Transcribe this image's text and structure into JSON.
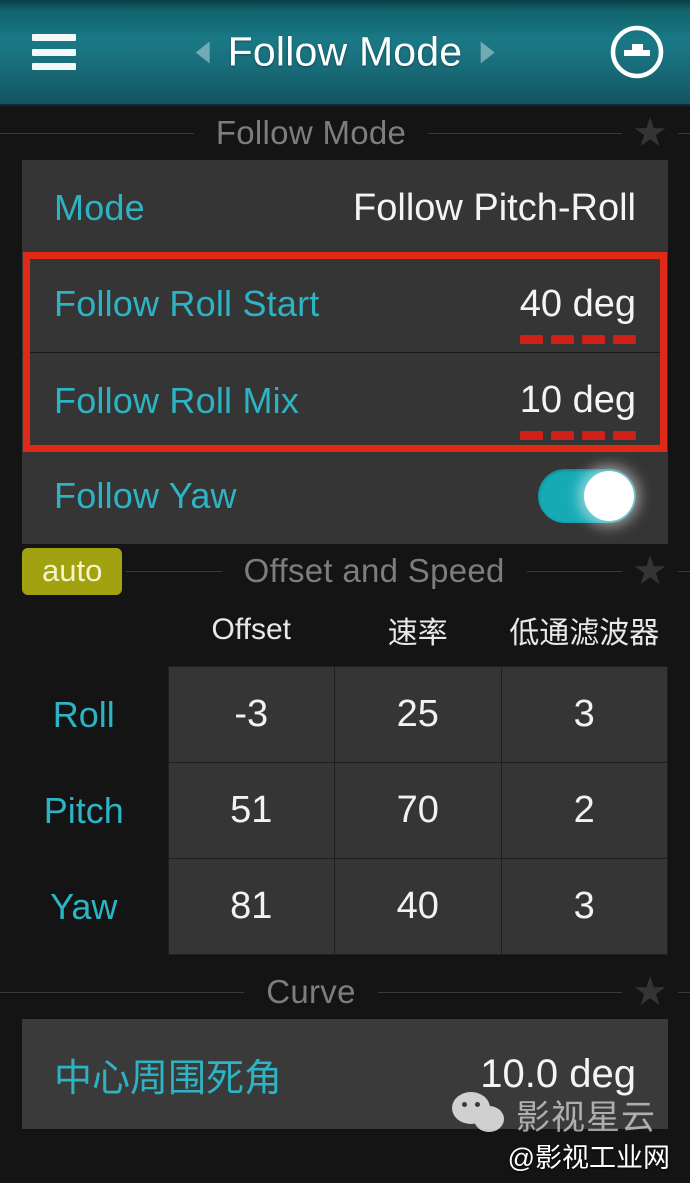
{
  "header": {
    "menu_icon": "hamburger-menu-icon",
    "prev_arrow": "chevron-left-icon",
    "next_arrow": "chevron-right-icon",
    "title": "Follow Mode",
    "right_icon": "gimbal-target-icon",
    "background_color": "#1a7986"
  },
  "sections": {
    "follow_mode": {
      "label": "Follow Mode",
      "star_glyph": "★",
      "rows": [
        {
          "label": "Mode",
          "value": "Follow Pitch-Roll",
          "highlighted": false
        },
        {
          "label": "Follow Roll Start",
          "value": "40 deg",
          "highlighted": true
        },
        {
          "label": "Follow Roll Mix",
          "value": "10 deg",
          "highlighted": true
        }
      ],
      "toggle_row": {
        "label": "Follow Yaw",
        "state": "on",
        "color": "#16aab5"
      }
    },
    "offset_and_speed": {
      "auto_label": "auto",
      "auto_color": "#a2a211",
      "label": "Offset and Speed",
      "star_glyph": "★",
      "columns": [
        "Offset",
        "速率",
        "低通滤波器"
      ],
      "rows": [
        {
          "axis": "Roll",
          "values": [
            "-3",
            "25",
            "3"
          ]
        },
        {
          "axis": "Pitch",
          "values": [
            "51",
            "70",
            "2"
          ]
        },
        {
          "axis": "Yaw",
          "values": [
            "81",
            "40",
            "3"
          ]
        }
      ]
    },
    "curve": {
      "label": "Curve",
      "star_glyph": "★",
      "rows": [
        {
          "label": "中心周围死角",
          "value": "10.0 deg"
        }
      ]
    }
  },
  "annotation": {
    "box_color": "#e02a18",
    "dash_color": "#cf2118",
    "dash_count": 4
  },
  "watermark": {
    "brand_text": "影视星云",
    "handle_text": "@影视工业网",
    "wechat_icon": "wechat-logo-icon"
  },
  "theme": {
    "accent": "#2db4c4",
    "card_bg": "#353535",
    "page_bg": "#141414",
    "section_label": "#7d7d7d"
  }
}
